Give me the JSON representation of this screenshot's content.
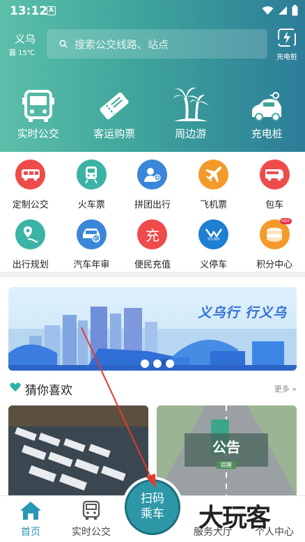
{
  "status_bar": {
    "time": "13:12",
    "a_badge": "A"
  },
  "header": {
    "city": "义乌",
    "weather": "霾 15℃",
    "search_placeholder": "搜索公交线路、站点",
    "charge_label": "充电桩"
  },
  "main_shortcuts": [
    {
      "label": "实时公交",
      "icon": "bus-icon"
    },
    {
      "label": "客运购票",
      "icon": "ticket-icon"
    },
    {
      "label": "周边游",
      "icon": "palm-tree-icon"
    },
    {
      "label": "充电桩",
      "icon": "electric-car-icon"
    }
  ],
  "services_row1": [
    {
      "label": "定制公交",
      "icon": "custom-bus-icon",
      "color": "#ef4b4b"
    },
    {
      "label": "火车票",
      "icon": "train-icon",
      "color": "#3bb3a4"
    },
    {
      "label": "拼团出行",
      "icon": "group-travel-icon",
      "color": "#3a86d8"
    },
    {
      "label": "飞机票",
      "icon": "airplane-icon",
      "color": "#f39a2b"
    },
    {
      "label": "包车",
      "icon": "charter-bus-icon",
      "color": "#ef4b4b"
    }
  ],
  "services_row2": [
    {
      "label": "出行规划",
      "icon": "route-plan-icon",
      "color": "#3bb3a4"
    },
    {
      "label": "汽车年审",
      "icon": "car-inspection-icon",
      "color": "#3a86d8"
    },
    {
      "label": "便民充值",
      "icon": "recharge-icon",
      "color": "#ef4b4b",
      "glyph": "充"
    },
    {
      "label": "义停车",
      "icon": "parking-icon",
      "color": "#1f7fd0",
      "glyph": "YCCRM"
    },
    {
      "label": "积分中心",
      "icon": "points-icon",
      "color": "#f39a2b",
      "badge": "HOT"
    }
  ],
  "banner": {
    "text": "义乌行 行义乌"
  },
  "guess": {
    "title": "猜你喜欢",
    "more": "更多",
    "notice_title": "公告",
    "notice_sub": "提醒"
  },
  "nav": {
    "home": "首页",
    "bus": "实时公交",
    "scan_line1": "扫码",
    "scan_line2": "乘车",
    "service": "服务大厅",
    "profile": "个人中心"
  },
  "watermark": "大玩客",
  "colors": {
    "accent": "#2a96b5",
    "header_start": "#5bbfa9",
    "header_end": "#2c7d98"
  }
}
